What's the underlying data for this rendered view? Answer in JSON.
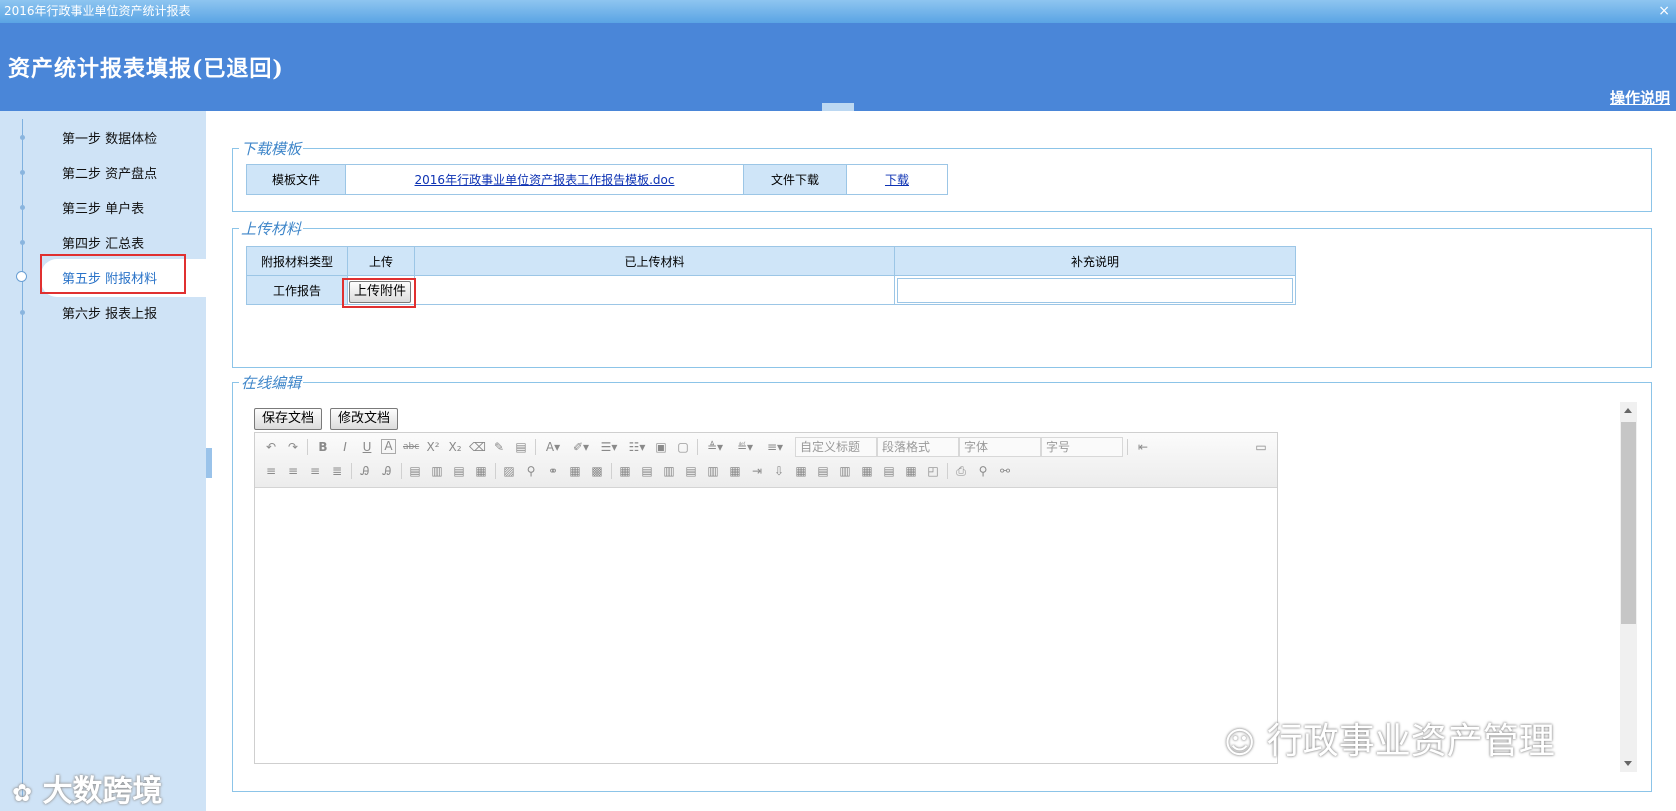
{
  "window": {
    "title": "2016年行政事业单位资产统计报表",
    "close": "×"
  },
  "header": {
    "title": "资产统计报表填报(已退回)",
    "help": "操作说明"
  },
  "sidebar": {
    "steps": [
      {
        "label": "第一步 数据体检"
      },
      {
        "label": "第二步 资产盘点"
      },
      {
        "label": "第三步 单户表"
      },
      {
        "label": "第四步 汇总表"
      },
      {
        "label": "第五步 附报材料"
      },
      {
        "label": "第六步 报表上报"
      }
    ],
    "active_index": 4
  },
  "download": {
    "legend": "下载模板",
    "template_label": "模板文件",
    "template_file": "2016年行政事业单位资产报表工作报告模板.doc",
    "file_download_label": "文件下载",
    "download_link": "下载"
  },
  "upload": {
    "legend": "上传材料",
    "columns": [
      "附报材料类型",
      "上传",
      "已上传材料",
      "补充说明"
    ],
    "rows": [
      {
        "type": "工作报告",
        "button": "上传附件",
        "uploaded": "",
        "note": ""
      }
    ]
  },
  "online_edit": {
    "legend": "在线编辑",
    "save_button": "保存文档",
    "modify_button": "修改文档",
    "toolbar": {
      "heading_select": "自定义标题",
      "paragraph_select": "段落格式",
      "font_select": "字体",
      "size_select": "字号",
      "row1_icons": [
        "undo-icon",
        "redo-icon",
        "bold-icon",
        "italic-icon",
        "underline-icon",
        "font-border-icon",
        "strikethrough-icon",
        "superscript-icon",
        "subscript-icon",
        "eraser-icon",
        "format-brush-icon",
        "paste-text-icon",
        "font-color-icon",
        "highlight-icon",
        "ordered-list-icon",
        "unordered-list-icon",
        "select-all-icon",
        "clear-doc-icon",
        "row-spacing-top-icon",
        "row-spacing-bottom-icon",
        "line-height-icon",
        "direction-icon",
        "preview-icon"
      ],
      "row2_icons": [
        "align-left-icon",
        "align-center-icon",
        "align-right-icon",
        "justify-icon",
        "indent-icon",
        "outdent-icon",
        "image-left-icon",
        "image-none-icon",
        "image-right-icon",
        "image-center-icon",
        "image-icon",
        "attachment-icon",
        "link-icon",
        "anchor-icon",
        "emotion-icon",
        "table-icon",
        "insert-row-icon",
        "insert-col-icon",
        "delete-row-icon",
        "delete-col-icon",
        "merge-cells-icon",
        "merge-right-icon",
        "merge-down-icon",
        "split-cells-icon",
        "split-rows-icon",
        "split-cols-icon",
        "table-props-icon",
        "cell-props-icon",
        "background-icon",
        "print-icon",
        "search-replace-icon",
        "find-icon"
      ]
    }
  },
  "watermarks": {
    "left": "大数跨境",
    "right": "行政事业资产管理"
  }
}
